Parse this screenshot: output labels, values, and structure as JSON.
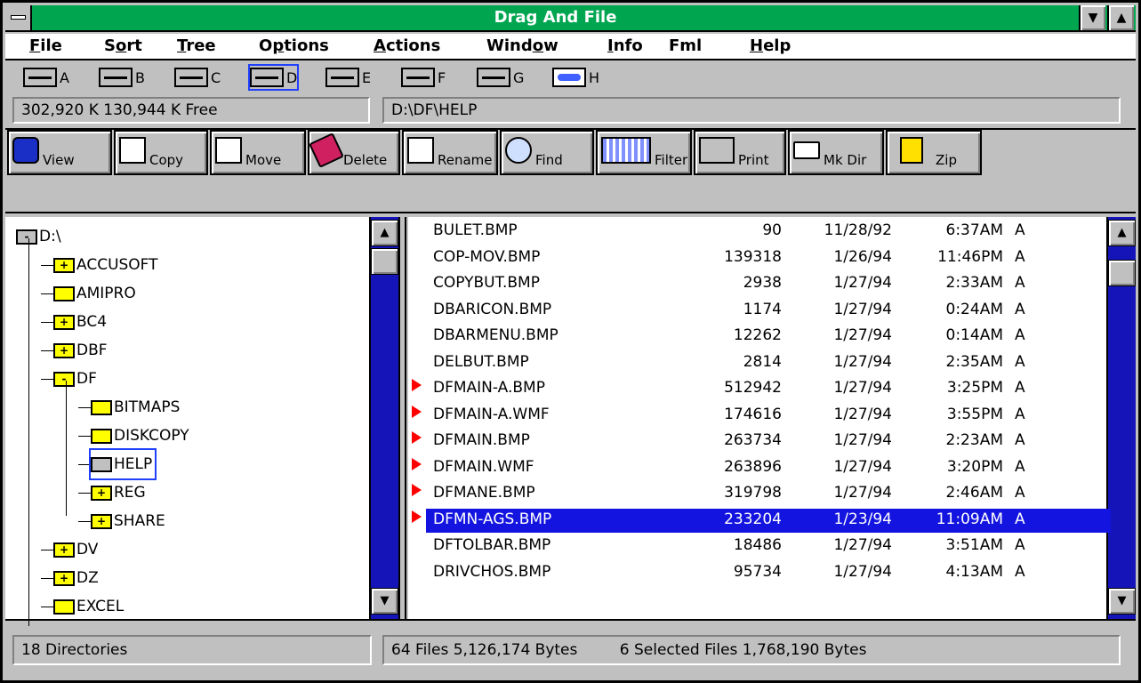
{
  "window": {
    "title": "Drag And File"
  },
  "menu": [
    {
      "pre": "",
      "u": "F",
      "post": "ile"
    },
    {
      "pre": "S",
      "u": "o",
      "post": "rt"
    },
    {
      "pre": "",
      "u": "T",
      "post": "ree"
    },
    {
      "pre": "O",
      "u": "p",
      "post": "tions"
    },
    {
      "pre": "",
      "u": "A",
      "post": "ctions"
    },
    {
      "pre": "Wind",
      "u": "o",
      "post": "w"
    },
    {
      "pre": "",
      "u": "I",
      "post": "nfo"
    },
    {
      "pre": "Fml",
      "u": "",
      "post": ""
    },
    {
      "pre": "",
      "u": "H",
      "post": "elp"
    }
  ],
  "drives": [
    "A",
    "B",
    "C",
    "D",
    "E",
    "F",
    "G",
    "H"
  ],
  "selected_drive": "D",
  "info": {
    "space": "302,920 K  130,944 K Free",
    "path": "D:\\DF\\HELP"
  },
  "toolbar": {
    "view": "View",
    "copy": "Copy",
    "move": "Move",
    "delete": "Delete",
    "rename": "Rename",
    "find": "Find",
    "filter": "Filter",
    "print": "Print",
    "mkdir": "Mk Dir",
    "zip": "Zip"
  },
  "tree": [
    {
      "label": "D:\\",
      "indent": 0,
      "sign": "-",
      "open": true
    },
    {
      "label": "ACCUSOFT",
      "indent": 1,
      "sign": "+"
    },
    {
      "label": "AMIPRO",
      "indent": 1,
      "sign": ""
    },
    {
      "label": "BC4",
      "indent": 1,
      "sign": "+"
    },
    {
      "label": "DBF",
      "indent": 1,
      "sign": "+"
    },
    {
      "label": "DF",
      "indent": 1,
      "sign": "-"
    },
    {
      "label": "BITMAPS",
      "indent": 2,
      "sign": ""
    },
    {
      "label": "DISKCOPY",
      "indent": 2,
      "sign": ""
    },
    {
      "label": "HELP",
      "indent": 2,
      "sign": "",
      "open": true,
      "selected": true
    },
    {
      "label": "REG",
      "indent": 2,
      "sign": "+"
    },
    {
      "label": "SHARE",
      "indent": 2,
      "sign": "+"
    },
    {
      "label": "DV",
      "indent": 1,
      "sign": "+"
    },
    {
      "label": "DZ",
      "indent": 1,
      "sign": "+"
    },
    {
      "label": "EXCEL",
      "indent": 1,
      "sign": ""
    }
  ],
  "files": [
    {
      "name": "BULET.BMP",
      "size": "90",
      "date": "11/28/92",
      "time": "6:37AM",
      "attr": "A"
    },
    {
      "name": "COP-MOV.BMP",
      "size": "139318",
      "date": "1/26/94",
      "time": "11:46PM",
      "attr": "A"
    },
    {
      "name": "COPYBUT.BMP",
      "size": "2938",
      "date": "1/27/94",
      "time": "2:33AM",
      "attr": "A"
    },
    {
      "name": "DBARICON.BMP",
      "size": "1174",
      "date": "1/27/94",
      "time": "0:24AM",
      "attr": "A"
    },
    {
      "name": "DBARMENU.BMP",
      "size": "12262",
      "date": "1/27/94",
      "time": "0:14AM",
      "attr": "A"
    },
    {
      "name": "DELBUT.BMP",
      "size": "2814",
      "date": "1/27/94",
      "time": "2:35AM",
      "attr": "A"
    },
    {
      "name": "DFMAIN-A.BMP",
      "size": "512942",
      "date": "1/27/94",
      "time": "3:25PM",
      "attr": "A",
      "marked": true
    },
    {
      "name": "DFMAIN-A.WMF",
      "size": "174616",
      "date": "1/27/94",
      "time": "3:55PM",
      "attr": "A",
      "marked": true
    },
    {
      "name": "DFMAIN.BMP",
      "size": "263734",
      "date": "1/27/94",
      "time": "2:23AM",
      "attr": "A",
      "marked": true
    },
    {
      "name": "DFMAIN.WMF",
      "size": "263896",
      "date": "1/27/94",
      "time": "3:20PM",
      "attr": "A",
      "marked": true
    },
    {
      "name": "DFMANE.BMP",
      "size": "319798",
      "date": "1/27/94",
      "time": "2:46AM",
      "attr": "A",
      "marked": true
    },
    {
      "name": "DFMN-AGS.BMP",
      "size": "233204",
      "date": "1/23/94",
      "time": "11:09AM",
      "attr": "A",
      "marked": true,
      "highlight": true
    },
    {
      "name": "DFTOLBAR.BMP",
      "size": "18486",
      "date": "1/27/94",
      "time": "3:51AM",
      "attr": "A"
    },
    {
      "name": "DRIVCHOS.BMP",
      "size": "95734",
      "date": "1/27/94",
      "time": "4:13AM",
      "attr": "A"
    }
  ],
  "status": {
    "dirs": "18 Directories",
    "files": "64 Files  5,126,174 Bytes",
    "selected": "6 Selected Files  1,768,190 Bytes"
  },
  "colors": {
    "title_bar": "#00a550",
    "highlight": "#1414e0",
    "scroll_track": "#1414b8",
    "marker": "#ff0000",
    "folder": "#ffff00"
  }
}
